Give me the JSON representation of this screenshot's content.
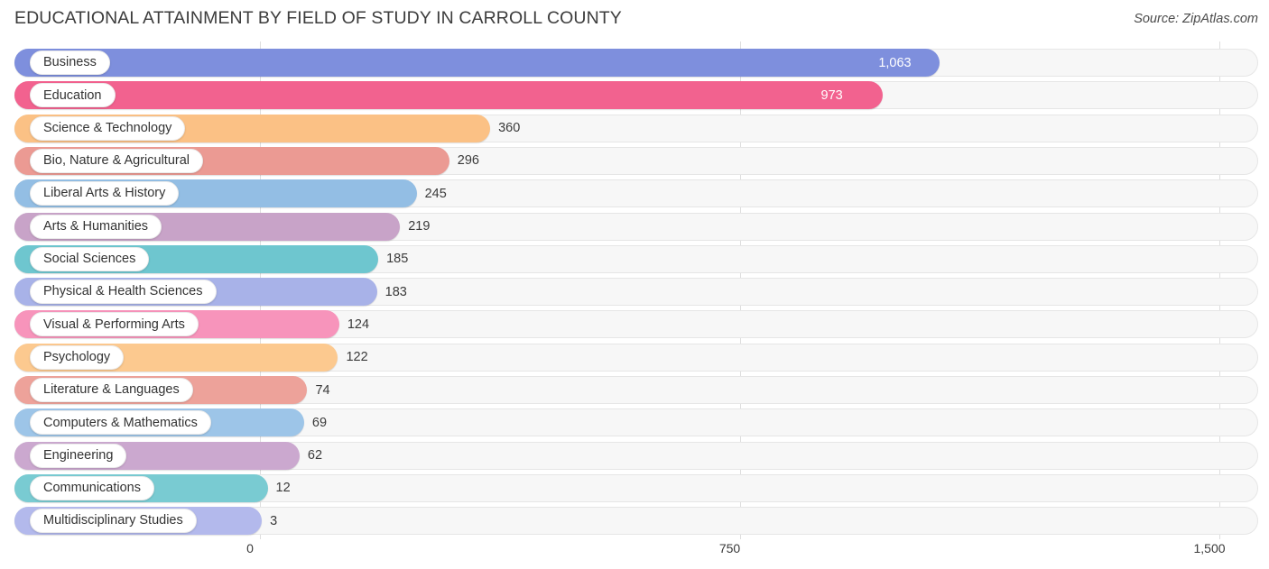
{
  "header": {
    "title": "EDUCATIONAL ATTAINMENT BY FIELD OF STUDY IN CARROLL COUNTY",
    "source": "Source: ZipAtlas.com"
  },
  "chart_data": {
    "type": "bar",
    "orientation": "horizontal",
    "title": "EDUCATIONAL ATTAINMENT BY FIELD OF STUDY IN CARROLL COUNTY",
    "subtitle": "",
    "xlabel": "",
    "ylabel": "",
    "xlim": [
      0,
      1500
    ],
    "grid": true,
    "legend": null,
    "xticks": [
      0,
      750,
      1500
    ],
    "xtick_labels": [
      "0",
      "750",
      "1,500"
    ],
    "categories": [
      "Business",
      "Education",
      "Science & Technology",
      "Bio, Nature & Agricultural",
      "Liberal Arts & History",
      "Arts & Humanities",
      "Social Sciences",
      "Physical & Health Sciences",
      "Visual & Performing Arts",
      "Psychology",
      "Literature & Languages",
      "Computers & Mathematics",
      "Engineering",
      "Communications",
      "Multidisciplinary Studies"
    ],
    "values": [
      1063,
      973,
      360,
      296,
      245,
      219,
      185,
      183,
      124,
      122,
      74,
      69,
      62,
      12,
      3
    ],
    "value_labels": [
      "1,063",
      "973",
      "360",
      "296",
      "245",
      "219",
      "185",
      "183",
      "124",
      "122",
      "74",
      "69",
      "62",
      "12",
      "3"
    ],
    "colors": [
      "#7e8fdd",
      "#f2628f",
      "#fbc185",
      "#eb9a93",
      "#93bee4",
      "#c8a3c8",
      "#6ec6cf",
      "#a8b2e8",
      "#f794bb",
      "#fcc98f",
      "#eda29a",
      "#9dc5e8",
      "#cba8cf",
      "#79cbd2",
      "#b3b9ec"
    ]
  }
}
